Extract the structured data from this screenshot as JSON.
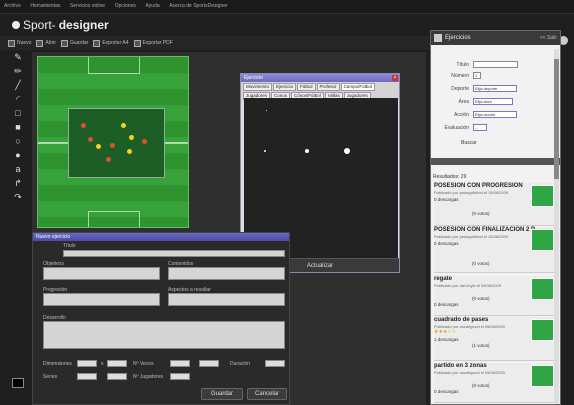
{
  "menu": [
    "Archivo",
    "Herramientas",
    "Servicios online",
    "Opciones",
    "Ayuda",
    "Acerca de SportsDesigner"
  ],
  "logo": {
    "part1": "Sport-",
    "part2": "designer"
  },
  "toolbar": [
    {
      "label": "Nuevo",
      "icon": "new-doc-icon"
    },
    {
      "label": "Abrir",
      "icon": "folder-icon"
    },
    {
      "label": "Guardar",
      "icon": "save-icon"
    },
    {
      "label": "Exportar A4",
      "icon": "export-icon"
    },
    {
      "label": "Exportar PDF",
      "icon": "pdf-icon"
    }
  ],
  "toolbar_right": [
    "tactic-board-icon",
    "sheet-icon",
    "ball-icon"
  ],
  "tools": [
    "marker-icon",
    "pencil-icon",
    "line-icon",
    "curve-icon",
    "rectangle-icon",
    "filled-rect-icon",
    "circle-icon",
    "filled-circle-icon",
    "text-icon",
    "arrow-curve-icon",
    "return-arrow-icon"
  ],
  "exercise_window": {
    "title": "Ejercicio",
    "tabs": [
      "Movimiento",
      "Ejercicio",
      "Fútbol",
      "Profesor",
      "Campo/Fútbol",
      "Jugadores",
      "Conos",
      "Cónos/Fútbol",
      "Vallas",
      "Jugadores"
    ],
    "footer_button": "Actualizar"
  },
  "form": {
    "title": "Nuevo ejercicio",
    "fields": {
      "titulo": "Título",
      "objetivos": "Objetivos",
      "contenidos": "Contenidos",
      "progresion": "Progresión",
      "aspectos": "Aspectos a resaltar",
      "desarrollo": "Desarrollo"
    },
    "row1": {
      "dimensiones": "Dimensiones",
      "x": "x",
      "nveces": "Nº Veces",
      "duracion": "Duración"
    },
    "row2": {
      "series": "Series",
      "jugadores": "Nº Jugadores"
    },
    "buttons": {
      "save": "Guardar",
      "cancel": "Cancelar"
    }
  },
  "panel": {
    "title": "Ejercicios",
    "close_label": "<< Salir",
    "filters": [
      {
        "label": "Título",
        "type": "input",
        "value": ""
      },
      {
        "label": "Número",
        "type": "input",
        "value": "1"
      },
      {
        "label": "Deporte",
        "type": "select",
        "value": "Elija deporte"
      },
      {
        "label": "Área",
        "type": "select",
        "value": "Elija área"
      },
      {
        "label": "Acción",
        "type": "select",
        "value": "Elija acción"
      },
      {
        "label": "Evaluación",
        "type": "select",
        "value": "--"
      }
    ],
    "search_button": "Buscar",
    "results_label": "Resultados: 29",
    "cards": [
      {
        "title": "POSESION CON PROGRESION",
        "sub": "Publicado por pedagofútbol el 15/06/2009",
        "downloads": "0 descargas",
        "votes": "(0 votos)"
      },
      {
        "title": "POSESION CON FINALIZACION 2 P",
        "sub": "Publicado por pedagofútbol el 15/06/2009",
        "downloads": "0 descargas",
        "votes": "(0 votos)"
      },
      {
        "title": "regate",
        "sub": "Publicado por alel-toyle el 09/06/2009",
        "downloads": "0 descargas",
        "votes": "(0 votos)"
      },
      {
        "title": "cuadrado de pases",
        "sub": "Publicado por uscdrigezxl el 05/06/2009",
        "downloads": "1 descargas",
        "votes": "(1 votos)"
      },
      {
        "title": "partido en 3 zonas",
        "sub": "Publicado por uscdrigezxl el 05/06/2009",
        "downloads": "0 descargas",
        "votes": "(0 votos)"
      }
    ]
  },
  "colors": {
    "field": "#38a23a",
    "zone": "#1c5e25",
    "accent": "#6a6ac0",
    "red_team": "#d9542a",
    "yellow_team": "#f2d21b"
  }
}
